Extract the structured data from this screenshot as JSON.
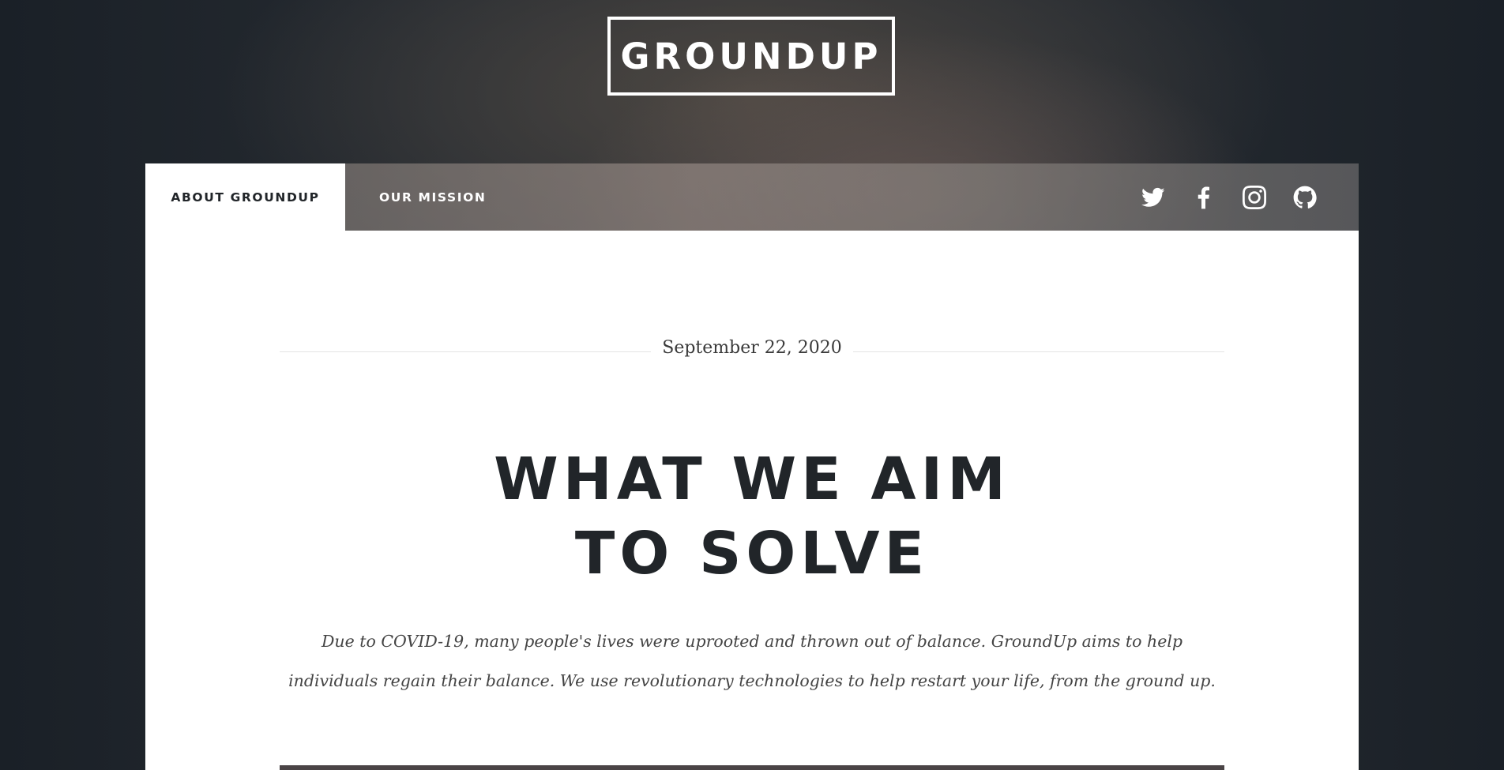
{
  "site": {
    "logo_text": "GROUNDUP"
  },
  "nav": {
    "tabs": [
      {
        "label": "ABOUT GROUNDUP",
        "active": true
      },
      {
        "label": "OUR MISSION",
        "active": false
      }
    ],
    "social_icons": [
      "twitter-icon",
      "facebook-icon",
      "instagram-icon",
      "github-icon"
    ]
  },
  "article": {
    "date": "September 22, 2020",
    "title_lines": [
      "WHAT WE AIM",
      "TO SOLVE"
    ],
    "lede": "Due to COVID-19, many people's lives were uprooted and thrown out of balance. GroundUp aims to help individuals regain their balance. We use revolutionary technologies to help restart your life, from the ground up."
  },
  "colors": {
    "page_background": "#1e242b",
    "card_background": "#ffffff",
    "heading_text": "#212529",
    "nav_text": "#ffffff"
  }
}
